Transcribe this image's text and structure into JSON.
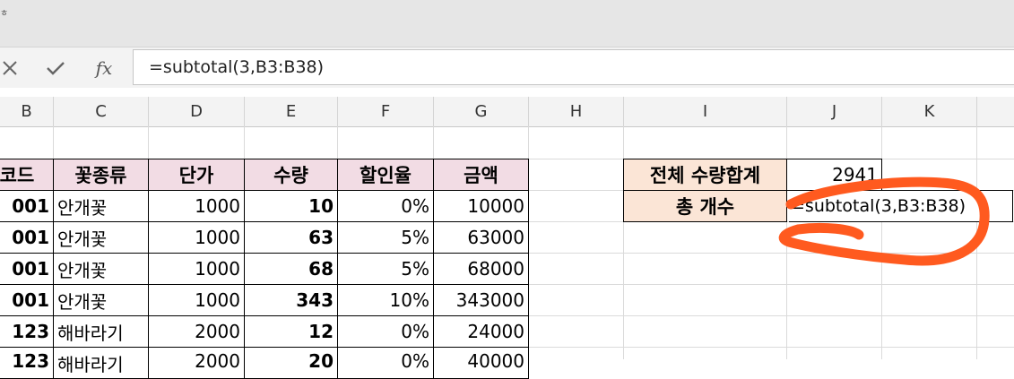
{
  "window": {
    "corner_mark": "ㅎ"
  },
  "formula_bar": {
    "cancel_icon": "close-icon",
    "confirm_icon": "check-icon",
    "fx_label": "fx",
    "formula": "=subtotal(3,B3:B38)"
  },
  "columns": [
    "B",
    "C",
    "D",
    "E",
    "F",
    "G",
    "H",
    "I",
    "J",
    "K"
  ],
  "table": {
    "headers": [
      "코드",
      "꽃종류",
      "단가",
      "수량",
      "할인율",
      "금액"
    ],
    "rows": [
      [
        "001",
        "안개꽃",
        "1000",
        "10",
        "0%",
        "10000"
      ],
      [
        "001",
        "안개꽃",
        "1000",
        "63",
        "5%",
        "63000"
      ],
      [
        "001",
        "안개꽃",
        "1000",
        "68",
        "5%",
        "68000"
      ],
      [
        "001",
        "안개꽃",
        "1000",
        "343",
        "10%",
        "343000"
      ],
      [
        "123",
        "해바라기",
        "2000",
        "12",
        "0%",
        "24000"
      ],
      [
        "123",
        "해바라기",
        "2000",
        "20",
        "0%",
        "40000"
      ]
    ]
  },
  "summary": {
    "total_label": "전체 수량합계",
    "total_value": "2941",
    "count_label": "총 개수",
    "count_formula": "=subtotal(3,B3:B38)"
  },
  "colors": {
    "header_fill": "#f2dce4",
    "label_fill": "#fbe5d6",
    "annotation": "#ff5a1f"
  }
}
